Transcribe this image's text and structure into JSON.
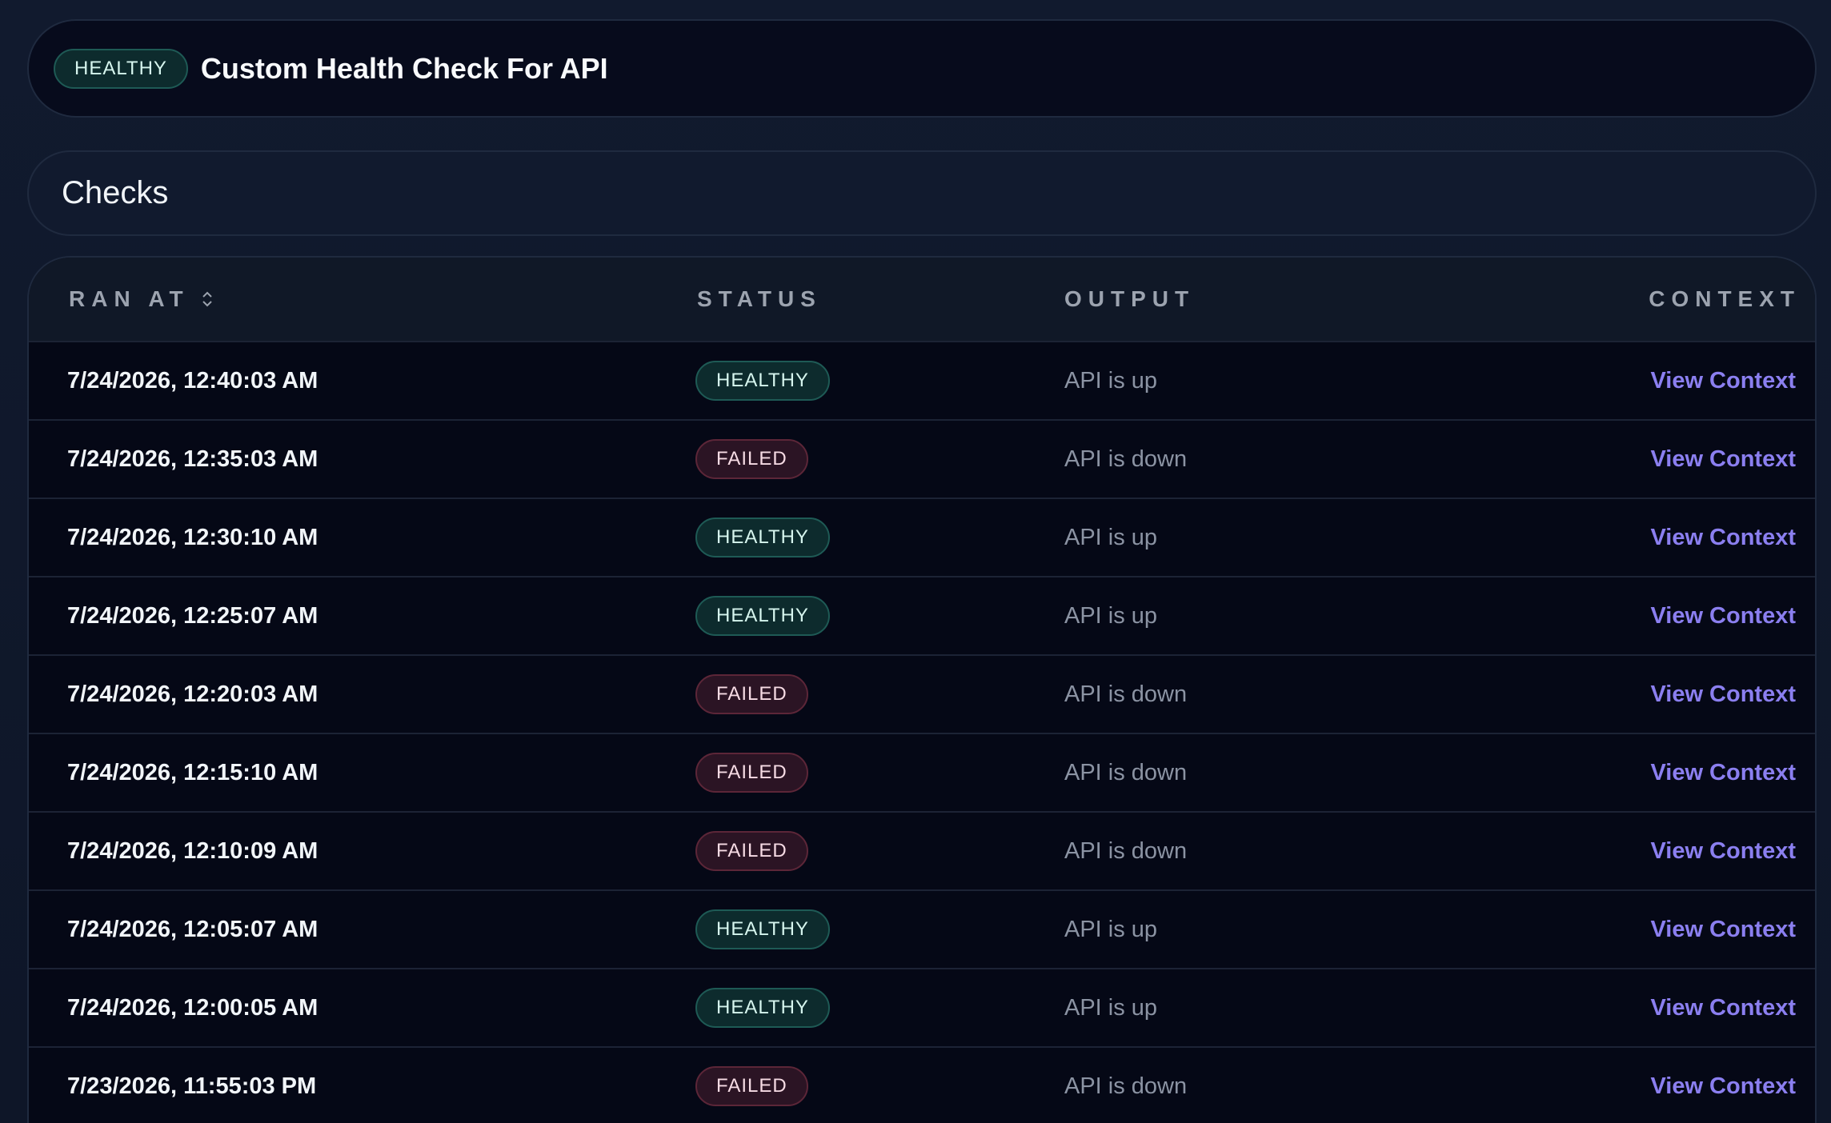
{
  "header": {
    "status": "HEALTHY",
    "title": "Custom Health Check For API"
  },
  "section": {
    "title": "Checks"
  },
  "table": {
    "columns": {
      "ran_at": "RAN AT",
      "status": "STATUS",
      "output": "OUTPUT",
      "context": "CONTEXT"
    },
    "rows": [
      {
        "ran_at": "7/24/2026, 12:40:03 AM",
        "status": "HEALTHY",
        "output": "API is up",
        "context": "View Context"
      },
      {
        "ran_at": "7/24/2026, 12:35:03 AM",
        "status": "FAILED",
        "output": "API is down",
        "context": "View Context"
      },
      {
        "ran_at": "7/24/2026, 12:30:10 AM",
        "status": "HEALTHY",
        "output": "API is up",
        "context": "View Context"
      },
      {
        "ran_at": "7/24/2026, 12:25:07 AM",
        "status": "HEALTHY",
        "output": "API is up",
        "context": "View Context"
      },
      {
        "ran_at": "7/24/2026, 12:20:03 AM",
        "status": "FAILED",
        "output": "API is down",
        "context": "View Context"
      },
      {
        "ran_at": "7/24/2026, 12:15:10 AM",
        "status": "FAILED",
        "output": "API is down",
        "context": "View Context"
      },
      {
        "ran_at": "7/24/2026, 12:10:09 AM",
        "status": "FAILED",
        "output": "API is down",
        "context": "View Context"
      },
      {
        "ran_at": "7/24/2026, 12:05:07 AM",
        "status": "HEALTHY",
        "output": "API is up",
        "context": "View Context"
      },
      {
        "ran_at": "7/24/2026, 12:00:05 AM",
        "status": "HEALTHY",
        "output": "API is up",
        "context": "View Context"
      },
      {
        "ran_at": "7/23/2026, 11:55:03 PM",
        "status": "FAILED",
        "output": "API is down",
        "context": "View Context"
      }
    ]
  },
  "colors": {
    "healthy": "#0d2b2d",
    "failed": "#2b1424",
    "link": "#8b7ff0"
  },
  "icons": {
    "sort": "sort-updown-icon"
  }
}
